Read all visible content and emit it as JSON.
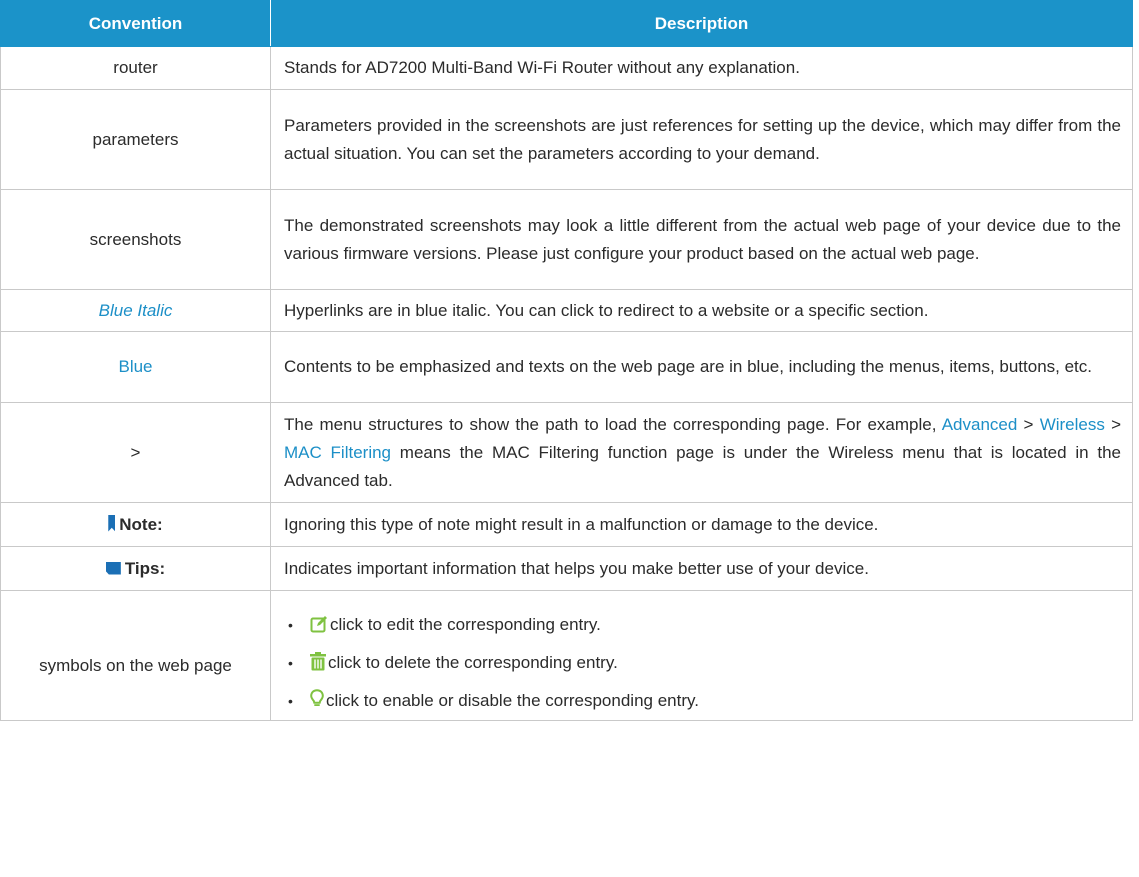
{
  "header": {
    "convention": "Convention",
    "description": "Description"
  },
  "rows": [
    {
      "convention": "router",
      "description": "Stands for AD7200 Multi-Band Wi-Fi Router without any explanation."
    },
    {
      "convention": "parameters",
      "description": "Parameters provided in the screenshots are just references for setting up the device, which may differ from the actual situation. You can set the parameters according to your demand."
    },
    {
      "convention": "screenshots",
      "description": "The demonstrated screenshots may look a little different from the actual web page of your device due to the various firmware versions. Please just configure your product based on the actual web page."
    },
    {
      "convention": "Blue Italic",
      "description": "Hyperlinks are in blue italic. You can click to redirect to a website or a specific section."
    },
    {
      "convention": "Blue",
      "description": "Contents to be emphasized and texts on the web page are in blue, including the menus, items, buttons, etc."
    },
    {
      "convention": ">",
      "description_pre": "The menu structures to show the path to load the corresponding page. For example, ",
      "path": [
        "Advanced",
        "Wireless",
        "MAC Filtering"
      ],
      "separator": " > ",
      "description_post": " means the MAC Filtering function page is under the Wireless menu that is located in the Advanced tab."
    },
    {
      "convention": "Note:",
      "description": "Ignoring this type of note might result in a malfunction or damage to the device."
    },
    {
      "convention": "Tips:",
      "description": "Indicates important information that helps you make better use of your device."
    },
    {
      "convention": "symbols on the web page",
      "items": [
        {
          "icon": "edit-icon",
          "text": "click to edit the corresponding entry."
        },
        {
          "icon": "trash-icon",
          "text": "click to delete the corresponding entry."
        },
        {
          "icon": "lightbulb-icon",
          "text": "click to enable or disable the corresponding entry."
        }
      ],
      "bullet": "•"
    }
  ],
  "colors": {
    "header_bg": "#1b93c9",
    "link_blue": "#1c8fc7",
    "icon_green": "#7fc241",
    "icon_blue": "#1b6fb5",
    "border": "#c9c9c9"
  }
}
